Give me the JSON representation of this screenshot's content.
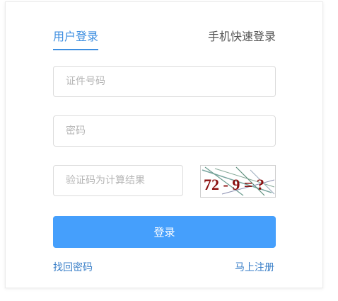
{
  "tabs": {
    "user_login": "用户登录",
    "phone_login": "手机快速登录"
  },
  "fields": {
    "id_placeholder": "证件号码",
    "password_placeholder": "密码",
    "captcha_placeholder": "验证码为计算结果"
  },
  "captcha": {
    "text": "72 - 9 = ?"
  },
  "login_button": "登录",
  "links": {
    "find_password": "找回密码",
    "register": "马上注册"
  },
  "colors": {
    "accent": "#3d8ee0",
    "button": "#459ffc",
    "link": "#3a7fc8"
  }
}
